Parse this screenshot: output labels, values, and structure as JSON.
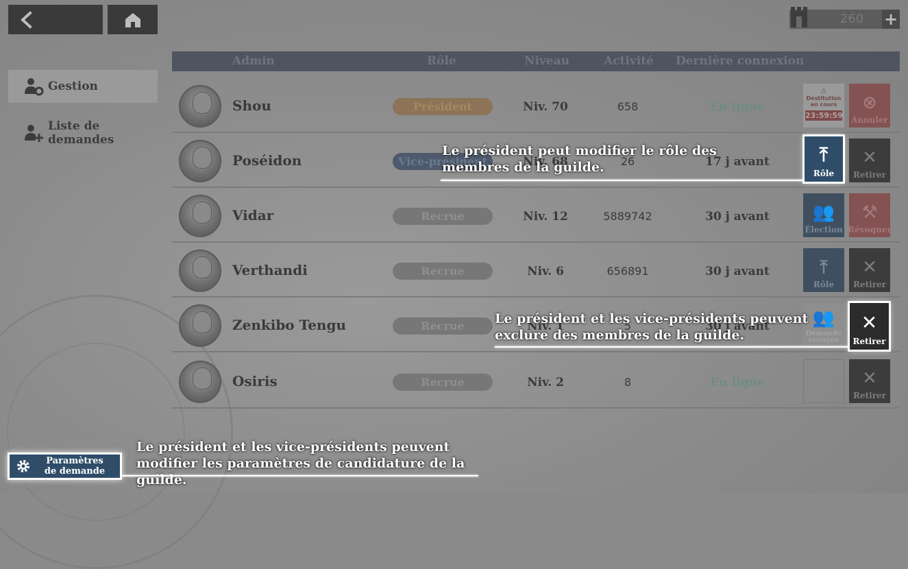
{
  "currency": {
    "value": "260",
    "icon": "castle-currency-icon",
    "plus_label": "+"
  },
  "sidebar": {
    "items": [
      {
        "label": "Gestion",
        "icon": "user-gear-icon",
        "active": true
      },
      {
        "label": "Liste de demandes",
        "icon": "user-add-icon",
        "active": false
      }
    ]
  },
  "table": {
    "headers": {
      "admin": "Admin",
      "role": "Rôle",
      "level": "Niveau",
      "activity": "Activité",
      "last": "Dernière connexion"
    },
    "rows": [
      {
        "name": "Shou",
        "role": "Président",
        "level": "Niv. 70",
        "activity": "658",
        "last": "En ligne",
        "dest_title": "Destitution en cours",
        "dest_timer": "23:59:59",
        "btn2": "Annuler"
      },
      {
        "name": "Poséidon",
        "role": "Vice-président",
        "level": "Niv. 68",
        "activity": "26",
        "last": "17 j avant",
        "btn1": "Rôle",
        "btn2": "Retirer"
      },
      {
        "name": "Vidar",
        "role": "Recrue",
        "level": "Niv. 12",
        "activity": "5889742",
        "last": "30 j avant",
        "btn1": "Élection",
        "btn2": "Révoquer"
      },
      {
        "name": "Verthandi",
        "role": "Recrue",
        "level": "Niv. 6",
        "activity": "656891",
        "last": "30 j avant",
        "btn1": "Rôle",
        "btn2": "Retirer"
      },
      {
        "name": "Zenkibo Tengu",
        "role": "Recrue",
        "level": "Niv. 1",
        "activity": "5",
        "last": "30 j avant",
        "btn1": "Demande envoyée",
        "btn2": "Retirer"
      },
      {
        "name": "Osiris",
        "role": "Recrue",
        "level": "Niv. 2",
        "activity": "8",
        "last": "En ligne",
        "btn2": "Retirer"
      }
    ]
  },
  "tutorial": {
    "tip_role": "Le président peut modifier le rôle des membres de la guilde.",
    "tip_kick": "Le président et les vice-présidents peuvent exclure des membres de la guilde.",
    "tip_params": "Le président et les vice-présidents peuvent modifier les paramètres de candidature de la guilde.",
    "highlight_role_label": "Rôle",
    "highlight_kick_label": "Retirer"
  },
  "params_button": {
    "line1": "Paramètres",
    "line2": "de demande"
  }
}
